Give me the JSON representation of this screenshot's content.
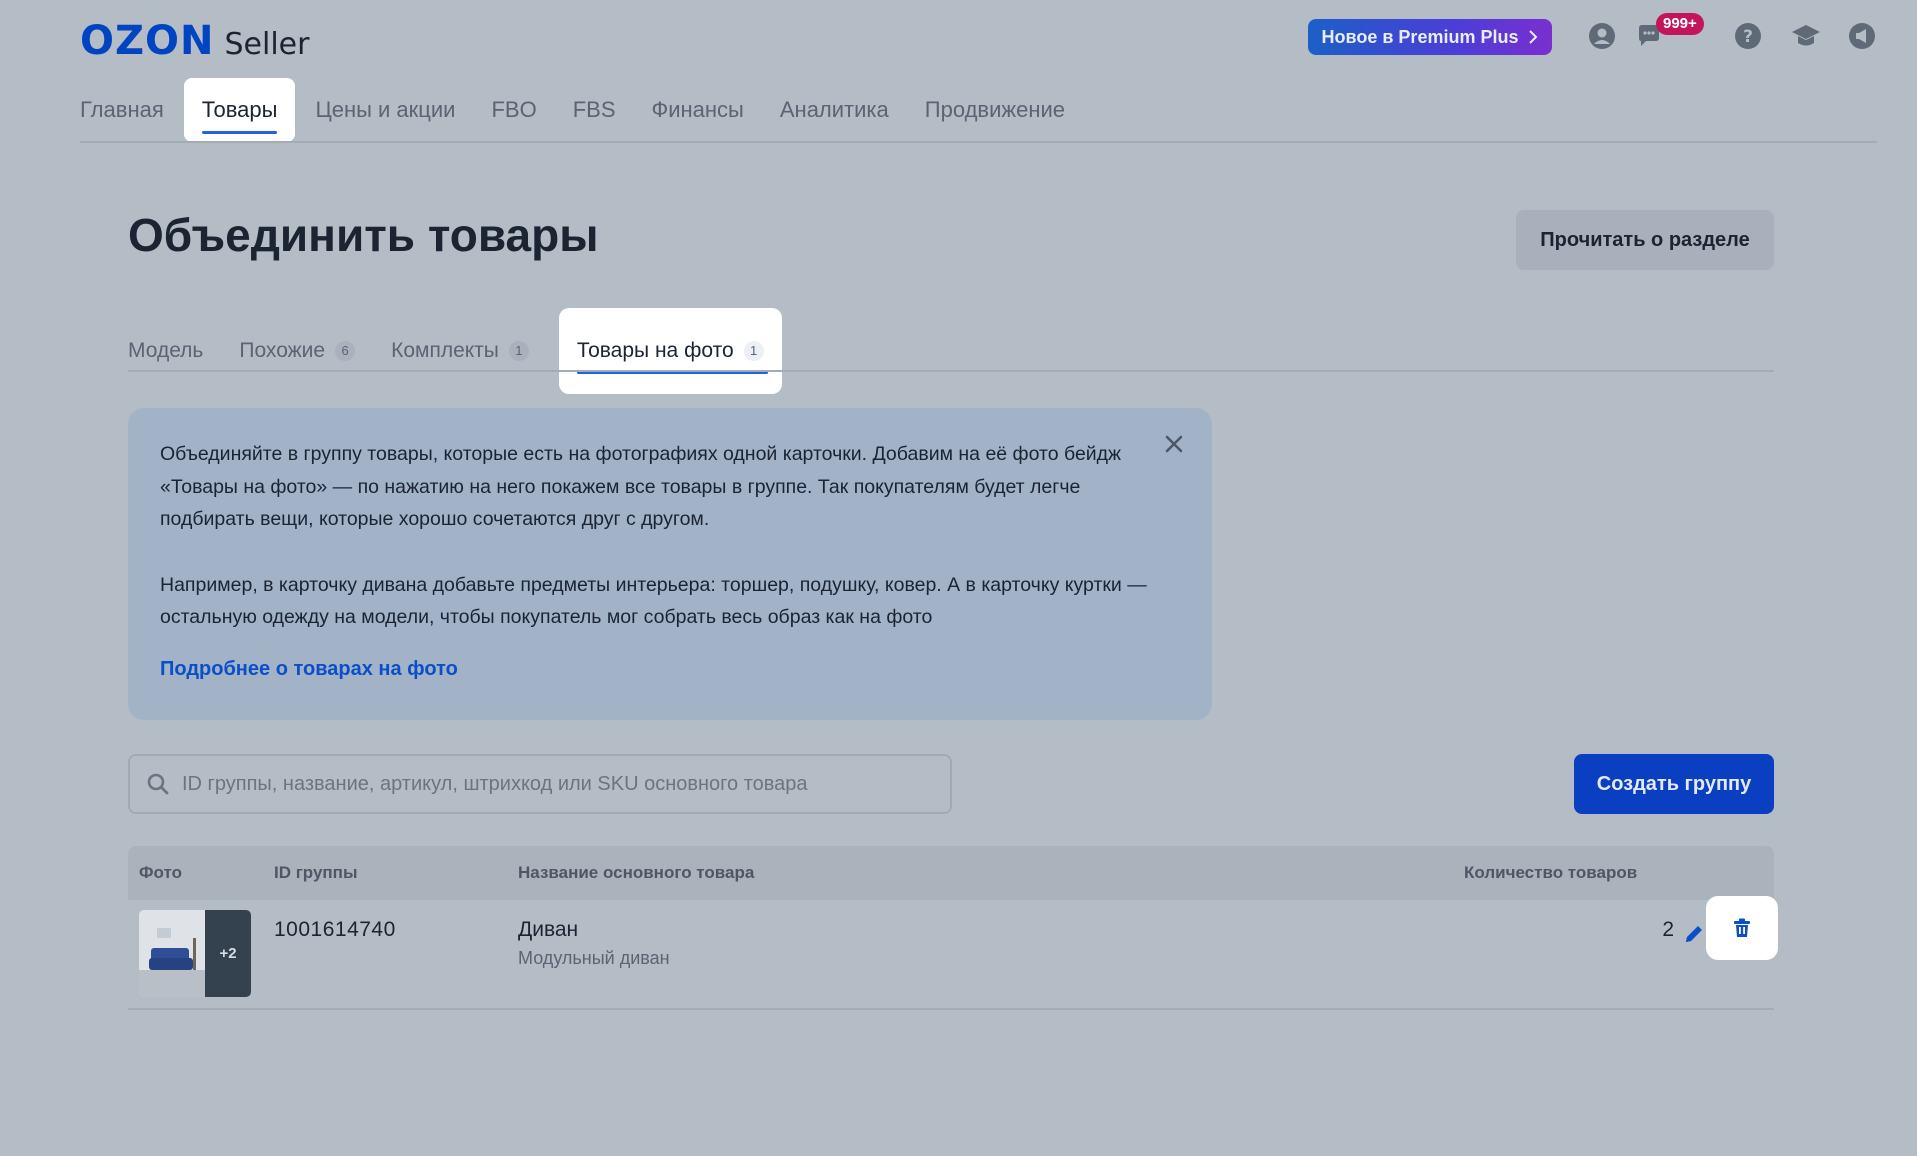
{
  "logo": {
    "brand": "OZON",
    "product": "Seller"
  },
  "header": {
    "premium_label": "Новое в Premium Plus",
    "chat_badge": "999+",
    "icons": [
      "user-icon",
      "chat-icon",
      "help-icon",
      "graduation-cap-icon",
      "megaphone-icon"
    ]
  },
  "nav": {
    "items": [
      {
        "label": "Главная"
      },
      {
        "label": "Товары",
        "active": true
      },
      {
        "label": "Цены и акции"
      },
      {
        "label": "FBO"
      },
      {
        "label": "FBS"
      },
      {
        "label": "Финансы"
      },
      {
        "label": "Аналитика"
      },
      {
        "label": "Продвижение"
      }
    ]
  },
  "page": {
    "title": "Объединить товары",
    "read_button": "Прочитать о разделе"
  },
  "tabs": [
    {
      "label": "Модель",
      "count": ""
    },
    {
      "label": "Похожие",
      "count": "6"
    },
    {
      "label": "Комплекты",
      "count": "1"
    },
    {
      "label": "Товары на фото",
      "count": "1",
      "active": true
    }
  ],
  "info": {
    "paragraph1": "Объединяйте в группу товары, которые есть на фотографиях одной карточки. Добавим на её фото бейдж «Товары на фото» — по нажатию на него покажем все товары в группе. Так покупателям будет легче подбирать вещи, которые хорошо сочетаются друг с другом.",
    "paragraph2": "Например, в карточку дивана добавьте предметы интерьера: торшер, подушку, ковер. А в карточку куртки — остальную одежду на модели, чтобы покупатель мог собрать весь образ как на фото",
    "link": "Подробнее о товарах на фото"
  },
  "search": {
    "value": "",
    "placeholder": "ID группы, название, артикул, штрихкод или SKU основного товара"
  },
  "create_button": "Создать группу",
  "table": {
    "columns": [
      "Фото",
      "ID группы",
      "Название основного товара",
      "Количество товаров"
    ],
    "rows": [
      {
        "photo_more": "+2",
        "group_id": "1001614740",
        "name": "Диван",
        "subtitle": "Модульный диван",
        "quantity": "2"
      }
    ]
  },
  "colors": {
    "accent": "#0a3fc2",
    "link": "#0b4fc8",
    "badge": "#c3155a",
    "background": "#b4bcc5",
    "info_background": "#a3b3c7"
  }
}
